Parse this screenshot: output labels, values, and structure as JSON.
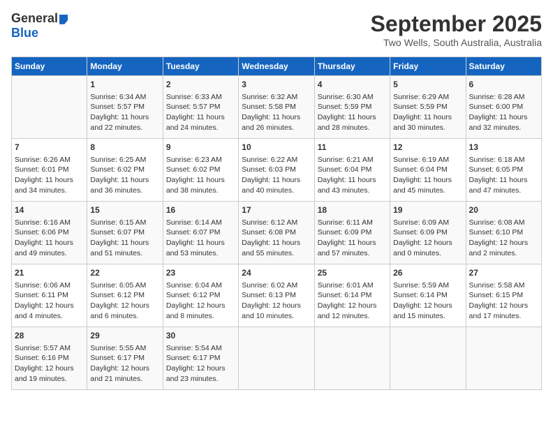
{
  "header": {
    "logo_general": "General",
    "logo_blue": "Blue",
    "month": "September 2025",
    "location": "Two Wells, South Australia, Australia"
  },
  "days_of_week": [
    "Sunday",
    "Monday",
    "Tuesday",
    "Wednesday",
    "Thursday",
    "Friday",
    "Saturday"
  ],
  "weeks": [
    [
      {
        "day": "",
        "info": ""
      },
      {
        "day": "1",
        "info": "Sunrise: 6:34 AM\nSunset: 5:57 PM\nDaylight: 11 hours\nand 22 minutes."
      },
      {
        "day": "2",
        "info": "Sunrise: 6:33 AM\nSunset: 5:57 PM\nDaylight: 11 hours\nand 24 minutes."
      },
      {
        "day": "3",
        "info": "Sunrise: 6:32 AM\nSunset: 5:58 PM\nDaylight: 11 hours\nand 26 minutes."
      },
      {
        "day": "4",
        "info": "Sunrise: 6:30 AM\nSunset: 5:59 PM\nDaylight: 11 hours\nand 28 minutes."
      },
      {
        "day": "5",
        "info": "Sunrise: 6:29 AM\nSunset: 5:59 PM\nDaylight: 11 hours\nand 30 minutes."
      },
      {
        "day": "6",
        "info": "Sunrise: 6:28 AM\nSunset: 6:00 PM\nDaylight: 11 hours\nand 32 minutes."
      }
    ],
    [
      {
        "day": "7",
        "info": "Sunrise: 6:26 AM\nSunset: 6:01 PM\nDaylight: 11 hours\nand 34 minutes."
      },
      {
        "day": "8",
        "info": "Sunrise: 6:25 AM\nSunset: 6:02 PM\nDaylight: 11 hours\nand 36 minutes."
      },
      {
        "day": "9",
        "info": "Sunrise: 6:23 AM\nSunset: 6:02 PM\nDaylight: 11 hours\nand 38 minutes."
      },
      {
        "day": "10",
        "info": "Sunrise: 6:22 AM\nSunset: 6:03 PM\nDaylight: 11 hours\nand 40 minutes."
      },
      {
        "day": "11",
        "info": "Sunrise: 6:21 AM\nSunset: 6:04 PM\nDaylight: 11 hours\nand 43 minutes."
      },
      {
        "day": "12",
        "info": "Sunrise: 6:19 AM\nSunset: 6:04 PM\nDaylight: 11 hours\nand 45 minutes."
      },
      {
        "day": "13",
        "info": "Sunrise: 6:18 AM\nSunset: 6:05 PM\nDaylight: 11 hours\nand 47 minutes."
      }
    ],
    [
      {
        "day": "14",
        "info": "Sunrise: 6:16 AM\nSunset: 6:06 PM\nDaylight: 11 hours\nand 49 minutes."
      },
      {
        "day": "15",
        "info": "Sunrise: 6:15 AM\nSunset: 6:07 PM\nDaylight: 11 hours\nand 51 minutes."
      },
      {
        "day": "16",
        "info": "Sunrise: 6:14 AM\nSunset: 6:07 PM\nDaylight: 11 hours\nand 53 minutes."
      },
      {
        "day": "17",
        "info": "Sunrise: 6:12 AM\nSunset: 6:08 PM\nDaylight: 11 hours\nand 55 minutes."
      },
      {
        "day": "18",
        "info": "Sunrise: 6:11 AM\nSunset: 6:09 PM\nDaylight: 11 hours\nand 57 minutes."
      },
      {
        "day": "19",
        "info": "Sunrise: 6:09 AM\nSunset: 6:09 PM\nDaylight: 12 hours\nand 0 minutes."
      },
      {
        "day": "20",
        "info": "Sunrise: 6:08 AM\nSunset: 6:10 PM\nDaylight: 12 hours\nand 2 minutes."
      }
    ],
    [
      {
        "day": "21",
        "info": "Sunrise: 6:06 AM\nSunset: 6:11 PM\nDaylight: 12 hours\nand 4 minutes."
      },
      {
        "day": "22",
        "info": "Sunrise: 6:05 AM\nSunset: 6:12 PM\nDaylight: 12 hours\nand 6 minutes."
      },
      {
        "day": "23",
        "info": "Sunrise: 6:04 AM\nSunset: 6:12 PM\nDaylight: 12 hours\nand 8 minutes."
      },
      {
        "day": "24",
        "info": "Sunrise: 6:02 AM\nSunset: 6:13 PM\nDaylight: 12 hours\nand 10 minutes."
      },
      {
        "day": "25",
        "info": "Sunrise: 6:01 AM\nSunset: 6:14 PM\nDaylight: 12 hours\nand 12 minutes."
      },
      {
        "day": "26",
        "info": "Sunrise: 5:59 AM\nSunset: 6:14 PM\nDaylight: 12 hours\nand 15 minutes."
      },
      {
        "day": "27",
        "info": "Sunrise: 5:58 AM\nSunset: 6:15 PM\nDaylight: 12 hours\nand 17 minutes."
      }
    ],
    [
      {
        "day": "28",
        "info": "Sunrise: 5:57 AM\nSunset: 6:16 PM\nDaylight: 12 hours\nand 19 minutes."
      },
      {
        "day": "29",
        "info": "Sunrise: 5:55 AM\nSunset: 6:17 PM\nDaylight: 12 hours\nand 21 minutes."
      },
      {
        "day": "30",
        "info": "Sunrise: 5:54 AM\nSunset: 6:17 PM\nDaylight: 12 hours\nand 23 minutes."
      },
      {
        "day": "",
        "info": ""
      },
      {
        "day": "",
        "info": ""
      },
      {
        "day": "",
        "info": ""
      },
      {
        "day": "",
        "info": ""
      }
    ]
  ]
}
